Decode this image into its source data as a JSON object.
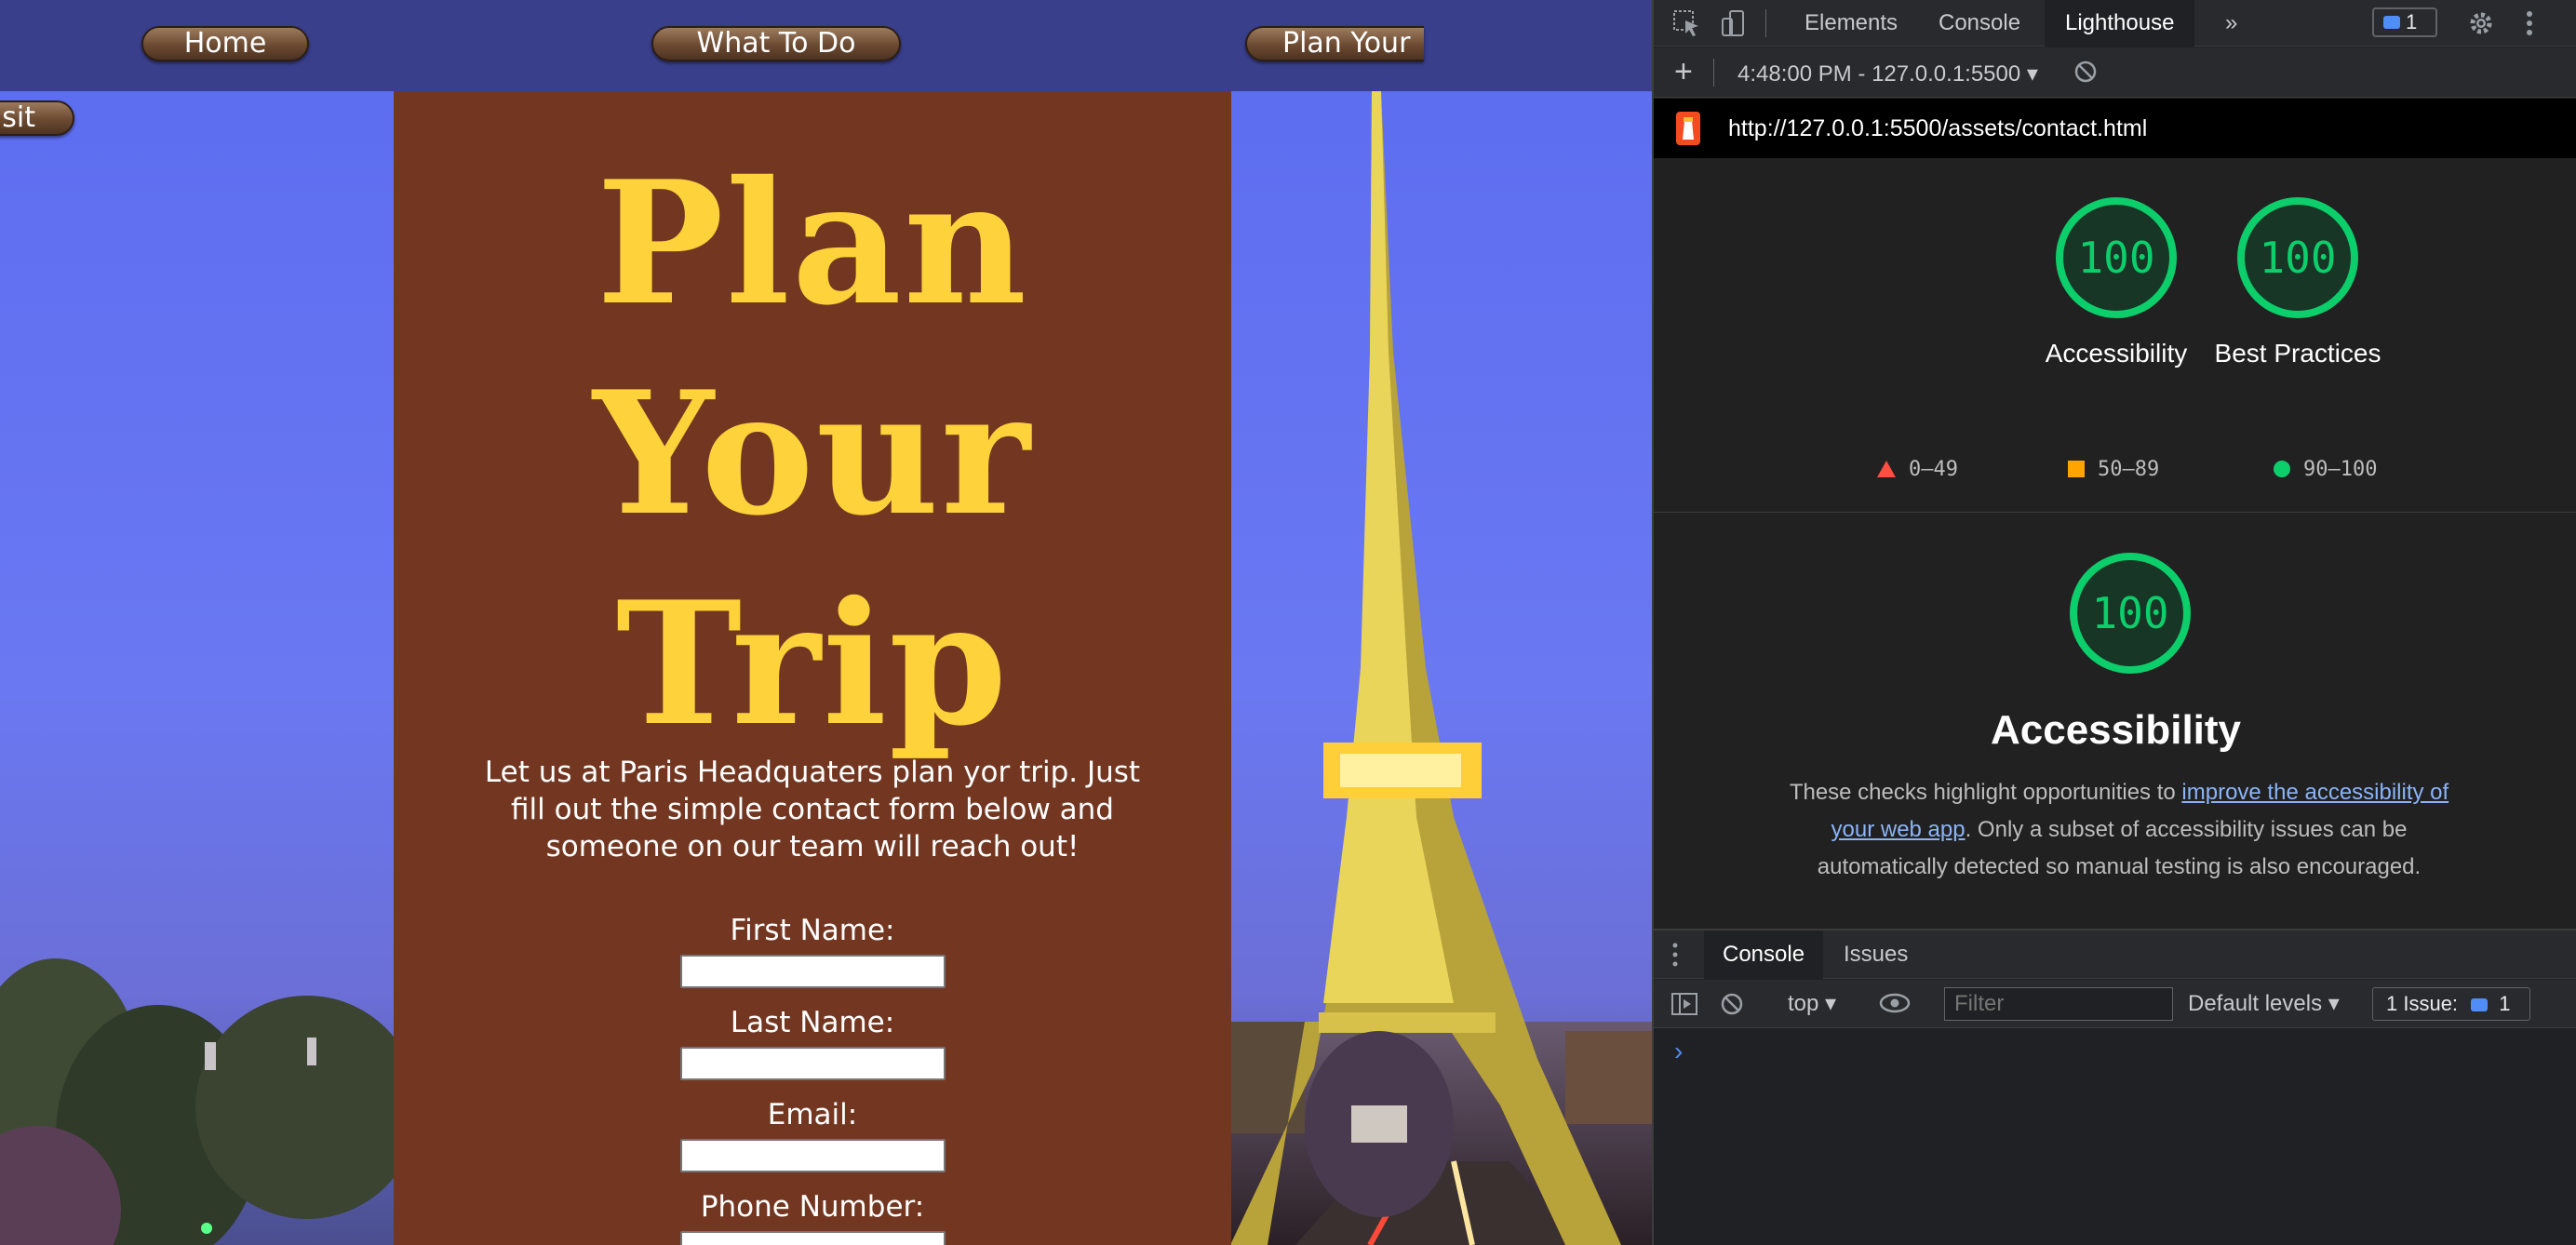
{
  "website": {
    "nav": {
      "home": "Home",
      "what_to_do": "What To Do",
      "plan_your": "Plan Your",
      "visit_fragment": "sit"
    },
    "title_lines": [
      "Plan",
      "Your",
      "Trip"
    ],
    "intro": "Let us at Paris Headquaters plan yor trip. Just fill out the simple contact form below and someone on our team will reach out!",
    "form": {
      "first_name": "First Name:",
      "last_name": "Last Name:",
      "email": "Email:",
      "phone": "Phone Number:"
    },
    "colors": {
      "panel": "#733721",
      "title": "#fdd23a",
      "navbar": "#3a3f8c"
    }
  },
  "devtools": {
    "tabs": [
      "Elements",
      "Console",
      "Lighthouse"
    ],
    "active_tab": "Lighthouse",
    "more_tabs": "»",
    "issue_badge_count": "1",
    "lighthouse": {
      "report_time": "4:48:00 PM - 127.0.0.1:5500 ▾",
      "url": "http://127.0.0.1:5500/assets/contact.html",
      "scores": [
        {
          "label": "Accessibility",
          "score": "100"
        },
        {
          "label": "Best Practices",
          "score": "100"
        }
      ],
      "legend": [
        {
          "range": "0–49",
          "color": "#ff4e42",
          "shape": "triangle"
        },
        {
          "range": "50–89",
          "color": "#ffa400",
          "shape": "square"
        },
        {
          "range": "90–100",
          "color": "#0cce6b",
          "shape": "circle"
        }
      ],
      "category": {
        "score": "100",
        "title": "Accessibility",
        "desc_before": "These checks highlight opportunities to ",
        "desc_link": "improve the accessibility of your web app",
        "desc_after": ". Only a subset of accessibility issues can be automatically detected so manual testing is also encouraged."
      }
    },
    "drawer": {
      "tabs": [
        "Console",
        "Issues"
      ],
      "active_tab": "Console",
      "context": "top ▾",
      "filter_placeholder": "Filter",
      "levels": "Default levels ▾",
      "issues": "1 Issue:",
      "issues_count": "1",
      "prompt": "›"
    }
  }
}
